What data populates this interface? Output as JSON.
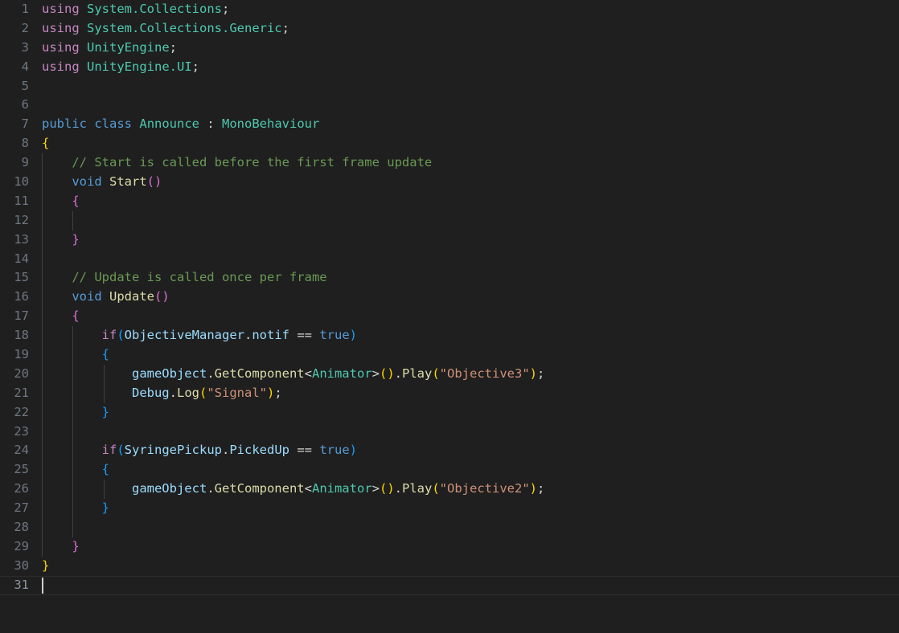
{
  "editor": {
    "background_color": "#1f1f1f",
    "gutter_color": "#6e7681",
    "current_line": 31,
    "total_lines": 31,
    "language": "csharp",
    "indent_guide_color": "#404040",
    "caret_color": "#d0d0d0",
    "palette": {
      "keyword": "#569cd6",
      "directive": "#c586c0",
      "type": "#4ec9b0",
      "function": "#dcdcaa",
      "variable": "#9cdcfe",
      "string": "#ce9178",
      "comment": "#6a9955",
      "punctuation": "#d4d4d4",
      "brace_level_1": "#ffd700",
      "brace_level_2": "#da70d6",
      "brace_level_3": "#179fff"
    }
  },
  "lines": [
    {
      "n": "1",
      "guides": [],
      "text": "using System.Collections;",
      "tokens": [
        {
          "t": "using",
          "c": "t-using"
        },
        {
          "t": " ",
          "c": "t-punc"
        },
        {
          "t": "System.Collections",
          "c": "t-type"
        },
        {
          "t": ";",
          "c": "t-punc"
        }
      ]
    },
    {
      "n": "2",
      "guides": [],
      "text": "using System.Collections.Generic;",
      "tokens": [
        {
          "t": "using",
          "c": "t-using"
        },
        {
          "t": " ",
          "c": "t-punc"
        },
        {
          "t": "System.Collections.Generic",
          "c": "t-type"
        },
        {
          "t": ";",
          "c": "t-punc"
        }
      ]
    },
    {
      "n": "3",
      "guides": [],
      "text": "using UnityEngine;",
      "tokens": [
        {
          "t": "using",
          "c": "t-using"
        },
        {
          "t": " ",
          "c": "t-punc"
        },
        {
          "t": "UnityEngine",
          "c": "t-type"
        },
        {
          "t": ";",
          "c": "t-punc"
        }
      ]
    },
    {
      "n": "4",
      "guides": [],
      "text": "using UnityEngine.UI;",
      "tokens": [
        {
          "t": "using",
          "c": "t-using"
        },
        {
          "t": " ",
          "c": "t-punc"
        },
        {
          "t": "UnityEngine.UI",
          "c": "t-type"
        },
        {
          "t": ";",
          "c": "t-punc"
        }
      ]
    },
    {
      "n": "5",
      "guides": [],
      "text": "",
      "tokens": []
    },
    {
      "n": "6",
      "guides": [],
      "text": "",
      "tokens": []
    },
    {
      "n": "7",
      "guides": [],
      "text": "public class Announce : MonoBehaviour",
      "tokens": [
        {
          "t": "public",
          "c": "t-kw"
        },
        {
          "t": " ",
          "c": "t-punc"
        },
        {
          "t": "class",
          "c": "t-kw"
        },
        {
          "t": " ",
          "c": "t-punc"
        },
        {
          "t": "Announce",
          "c": "t-type"
        },
        {
          "t": " : ",
          "c": "t-punc"
        },
        {
          "t": "MonoBehaviour",
          "c": "t-type"
        }
      ]
    },
    {
      "n": "8",
      "guides": [],
      "text": "{",
      "tokens": [
        {
          "t": "{",
          "c": "t-brace1"
        }
      ]
    },
    {
      "n": "9",
      "guides": [
        0
      ],
      "text": "    // Start is called before the first frame update",
      "tokens": [
        {
          "t": "    ",
          "c": "t-punc"
        },
        {
          "t": "// Start is called before the first frame update",
          "c": "t-cmt"
        }
      ]
    },
    {
      "n": "10",
      "guides": [
        0
      ],
      "text": "    void Start()",
      "tokens": [
        {
          "t": "    ",
          "c": "t-punc"
        },
        {
          "t": "void",
          "c": "t-kw"
        },
        {
          "t": " ",
          "c": "t-punc"
        },
        {
          "t": "Start",
          "c": "t-fn"
        },
        {
          "t": "(",
          "c": "t-brace2"
        },
        {
          "t": ")",
          "c": "t-brace2"
        }
      ]
    },
    {
      "n": "11",
      "guides": [
        0
      ],
      "text": "    {",
      "tokens": [
        {
          "t": "    ",
          "c": "t-punc"
        },
        {
          "t": "{",
          "c": "t-brace2"
        }
      ]
    },
    {
      "n": "12",
      "guides": [
        0,
        1
      ],
      "text": "",
      "tokens": []
    },
    {
      "n": "13",
      "guides": [
        0
      ],
      "text": "    }",
      "tokens": [
        {
          "t": "    ",
          "c": "t-punc"
        },
        {
          "t": "}",
          "c": "t-brace2"
        }
      ]
    },
    {
      "n": "14",
      "guides": [
        0
      ],
      "text": "",
      "tokens": []
    },
    {
      "n": "15",
      "guides": [
        0
      ],
      "text": "    // Update is called once per frame",
      "tokens": [
        {
          "t": "    ",
          "c": "t-punc"
        },
        {
          "t": "// Update is called once per frame",
          "c": "t-cmt"
        }
      ]
    },
    {
      "n": "16",
      "guides": [
        0
      ],
      "text": "    void Update()",
      "tokens": [
        {
          "t": "    ",
          "c": "t-punc"
        },
        {
          "t": "void",
          "c": "t-kw"
        },
        {
          "t": " ",
          "c": "t-punc"
        },
        {
          "t": "Update",
          "c": "t-fn"
        },
        {
          "t": "(",
          "c": "t-brace2"
        },
        {
          "t": ")",
          "c": "t-brace2"
        }
      ]
    },
    {
      "n": "17",
      "guides": [
        0
      ],
      "text": "    {",
      "tokens": [
        {
          "t": "    ",
          "c": "t-punc"
        },
        {
          "t": "{",
          "c": "t-brace2"
        }
      ]
    },
    {
      "n": "18",
      "guides": [
        0,
        1
      ],
      "text": "        if(ObjectiveManager.notif == true)",
      "tokens": [
        {
          "t": "        ",
          "c": "t-punc"
        },
        {
          "t": "if",
          "c": "t-using"
        },
        {
          "t": "(",
          "c": "t-brace3"
        },
        {
          "t": "ObjectiveManager",
          "c": "t-var"
        },
        {
          "t": ".",
          "c": "t-punc"
        },
        {
          "t": "notif",
          "c": "t-var"
        },
        {
          "t": " == ",
          "c": "t-punc"
        },
        {
          "t": "true",
          "c": "t-kw"
        },
        {
          "t": ")",
          "c": "t-brace3"
        }
      ]
    },
    {
      "n": "19",
      "guides": [
        0,
        1
      ],
      "text": "        {",
      "tokens": [
        {
          "t": "        ",
          "c": "t-punc"
        },
        {
          "t": "{",
          "c": "t-brace3"
        }
      ]
    },
    {
      "n": "20",
      "guides": [
        0,
        1,
        2
      ],
      "text": "            gameObject.GetComponent<Animator>().Play(\"Objective3\");",
      "tokens": [
        {
          "t": "            ",
          "c": "t-punc"
        },
        {
          "t": "gameObject",
          "c": "t-var"
        },
        {
          "t": ".",
          "c": "t-punc"
        },
        {
          "t": "GetComponent",
          "c": "t-fn"
        },
        {
          "t": "<",
          "c": "t-punc"
        },
        {
          "t": "Animator",
          "c": "t-type"
        },
        {
          "t": ">",
          "c": "t-punc"
        },
        {
          "t": "()",
          "c": "t-brace1"
        },
        {
          "t": ".",
          "c": "t-punc"
        },
        {
          "t": "Play",
          "c": "t-fn"
        },
        {
          "t": "(",
          "c": "t-brace1"
        },
        {
          "t": "\"Objective3\"",
          "c": "t-str"
        },
        {
          "t": ")",
          "c": "t-brace1"
        },
        {
          "t": ";",
          "c": "t-punc"
        }
      ]
    },
    {
      "n": "21",
      "guides": [
        0,
        1,
        2
      ],
      "text": "            Debug.Log(\"Signal\");",
      "tokens": [
        {
          "t": "            ",
          "c": "t-punc"
        },
        {
          "t": "Debug",
          "c": "t-var"
        },
        {
          "t": ".",
          "c": "t-punc"
        },
        {
          "t": "Log",
          "c": "t-fn"
        },
        {
          "t": "(",
          "c": "t-brace1"
        },
        {
          "t": "\"Signal\"",
          "c": "t-str"
        },
        {
          "t": ")",
          "c": "t-brace1"
        },
        {
          "t": ";",
          "c": "t-punc"
        }
      ]
    },
    {
      "n": "22",
      "guides": [
        0,
        1
      ],
      "text": "        }",
      "tokens": [
        {
          "t": "        ",
          "c": "t-punc"
        },
        {
          "t": "}",
          "c": "t-brace3"
        }
      ]
    },
    {
      "n": "23",
      "guides": [
        0,
        1
      ],
      "text": "",
      "tokens": []
    },
    {
      "n": "24",
      "guides": [
        0,
        1
      ],
      "text": "        if(SyringePickup.PickedUp == true)",
      "tokens": [
        {
          "t": "        ",
          "c": "t-punc"
        },
        {
          "t": "if",
          "c": "t-using"
        },
        {
          "t": "(",
          "c": "t-brace3"
        },
        {
          "t": "SyringePickup",
          "c": "t-var"
        },
        {
          "t": ".",
          "c": "t-punc"
        },
        {
          "t": "PickedUp",
          "c": "t-var"
        },
        {
          "t": " == ",
          "c": "t-punc"
        },
        {
          "t": "true",
          "c": "t-kw"
        },
        {
          "t": ")",
          "c": "t-brace3"
        }
      ]
    },
    {
      "n": "25",
      "guides": [
        0,
        1
      ],
      "text": "        {",
      "tokens": [
        {
          "t": "        ",
          "c": "t-punc"
        },
        {
          "t": "{",
          "c": "t-brace3"
        }
      ]
    },
    {
      "n": "26",
      "guides": [
        0,
        1,
        2
      ],
      "text": "            gameObject.GetComponent<Animator>().Play(\"Objective2\");",
      "tokens": [
        {
          "t": "            ",
          "c": "t-punc"
        },
        {
          "t": "gameObject",
          "c": "t-var"
        },
        {
          "t": ".",
          "c": "t-punc"
        },
        {
          "t": "GetComponent",
          "c": "t-fn"
        },
        {
          "t": "<",
          "c": "t-punc"
        },
        {
          "t": "Animator",
          "c": "t-type"
        },
        {
          "t": ">",
          "c": "t-punc"
        },
        {
          "t": "()",
          "c": "t-brace1"
        },
        {
          "t": ".",
          "c": "t-punc"
        },
        {
          "t": "Play",
          "c": "t-fn"
        },
        {
          "t": "(",
          "c": "t-brace1"
        },
        {
          "t": "\"Objective2\"",
          "c": "t-str"
        },
        {
          "t": ")",
          "c": "t-brace1"
        },
        {
          "t": ";",
          "c": "t-punc"
        }
      ]
    },
    {
      "n": "27",
      "guides": [
        0,
        1
      ],
      "text": "        }",
      "tokens": [
        {
          "t": "        ",
          "c": "t-punc"
        },
        {
          "t": "}",
          "c": "t-brace3"
        }
      ]
    },
    {
      "n": "28",
      "guides": [
        0,
        1
      ],
      "text": "",
      "tokens": []
    },
    {
      "n": "29",
      "guides": [
        0
      ],
      "text": "    }",
      "tokens": [
        {
          "t": "    ",
          "c": "t-punc"
        },
        {
          "t": "}",
          "c": "t-brace2"
        }
      ]
    },
    {
      "n": "30",
      "guides": [],
      "text": "}",
      "tokens": [
        {
          "t": "}",
          "c": "t-brace1"
        }
      ]
    },
    {
      "n": "31",
      "guides": [],
      "text": "",
      "tokens": [],
      "current": true,
      "caret": true
    }
  ]
}
